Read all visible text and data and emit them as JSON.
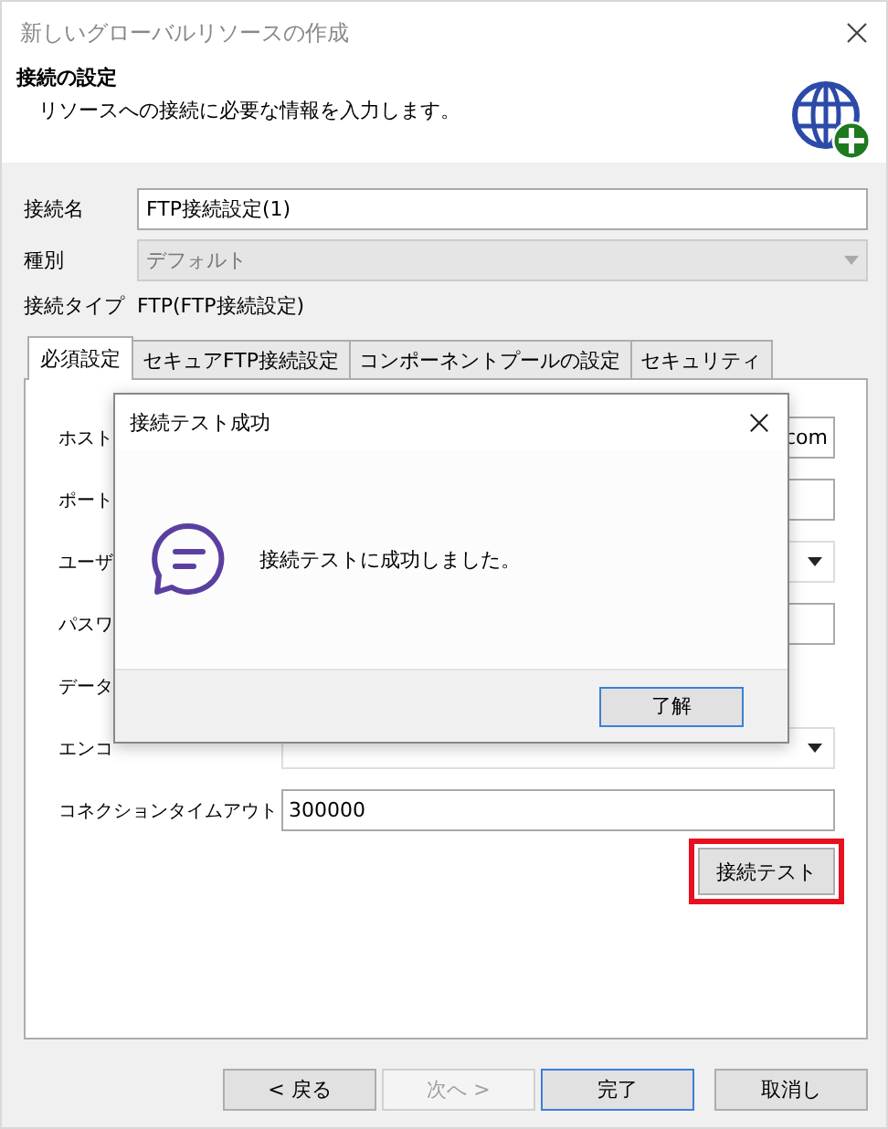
{
  "window": {
    "title": "新しいグローバルリソースの作成"
  },
  "header": {
    "title": "接続の設定",
    "subtitle": "リソースへの接続に必要な情報を入力します。"
  },
  "fields": [
    {
      "label": "接続名",
      "kind": "text",
      "value": "FTP接続設定(1)",
      "disabled": false
    },
    {
      "label": "種別",
      "kind": "dropdown",
      "value": "デフォルト",
      "disabled": true
    }
  ],
  "connection_type": {
    "label": "接続タイプ",
    "value": "FTP(FTP接続設定)"
  },
  "tabs": [
    {
      "label": "必須設定",
      "selected": true
    },
    {
      "label": "セキュアFTP接続設定",
      "selected": false
    },
    {
      "label": "コンポーネントプールの設定",
      "selected": false
    },
    {
      "label": "セキュリティ",
      "selected": false
    }
  ],
  "panel_rows": [
    {
      "label": "ホスト",
      "kind": "text",
      "value": "com"
    },
    {
      "label": "ポート",
      "kind": "text"
    },
    {
      "label": "ユーザ",
      "kind": "dropdown"
    },
    {
      "label": "パスワ",
      "kind": "text"
    },
    {
      "label": "データ",
      "kind": "none"
    },
    {
      "label": "エンコ",
      "kind": "dropdown"
    },
    {
      "label": "コネクションタイムアウト",
      "kind": "text",
      "value": "300000"
    }
  ],
  "test_button": {
    "label": "接続テスト",
    "highlighted": true
  },
  "buttons": [
    {
      "label": "< 戻る",
      "disabled": false,
      "default": false
    },
    {
      "label": "次へ >",
      "disabled": true,
      "default": false
    },
    {
      "label": "完了",
      "disabled": false,
      "default": true
    },
    {
      "label": "取消し",
      "disabled": false,
      "default": false
    }
  ],
  "dialog": {
    "title": "接続テスト成功",
    "message": "接続テストに成功しました。",
    "button": "了解"
  }
}
